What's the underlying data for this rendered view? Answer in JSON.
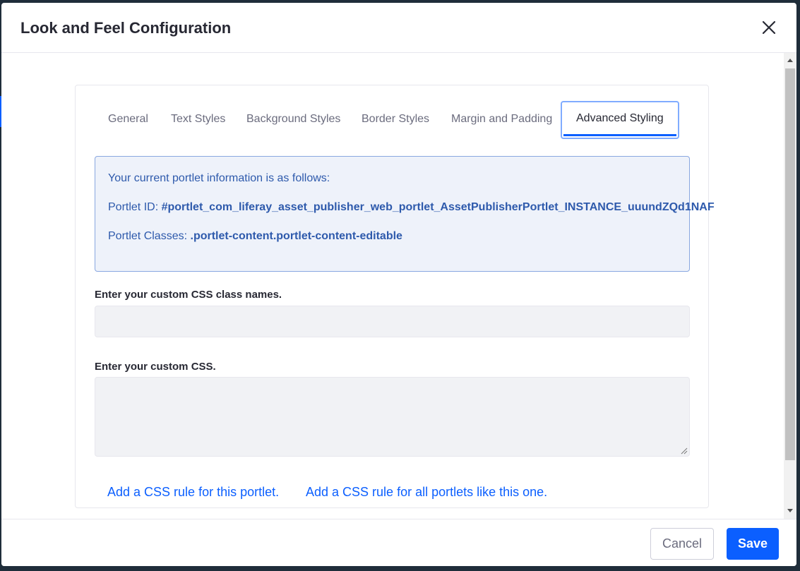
{
  "modal": {
    "title": "Look and Feel Configuration"
  },
  "tabs": [
    {
      "label": "General"
    },
    {
      "label": "Text Styles"
    },
    {
      "label": "Background Styles"
    },
    {
      "label": "Border Styles"
    },
    {
      "label": "Margin and Padding"
    },
    {
      "label": "Advanced Styling",
      "active": true
    }
  ],
  "info": {
    "intro": "Your current portlet information is as follows:",
    "portlet_id_label": "Portlet ID:",
    "portlet_id_value": "#portlet_com_liferay_asset_publisher_web_portlet_AssetPublisherPortlet_INSTANCE_uuundZQd1NAF",
    "portlet_classes_label": "Portlet Classes:",
    "portlet_classes_value": ".portlet-content.portlet-content-editable"
  },
  "fields": {
    "css_class_label": "Enter your custom CSS class names.",
    "css_class_value": "",
    "custom_css_label": "Enter your custom CSS.",
    "custom_css_value": ""
  },
  "links": {
    "add_rule_this": "Add a CSS rule for this portlet.",
    "add_rule_all": "Add a CSS rule for all portlets like this one."
  },
  "footer": {
    "cancel_label": "Cancel",
    "save_label": "Save"
  },
  "colors": {
    "primary": "#0b5fff",
    "info_bg": "#eef2fa",
    "info_text": "#2e5aac"
  },
  "icons": {
    "close": "close-icon"
  }
}
